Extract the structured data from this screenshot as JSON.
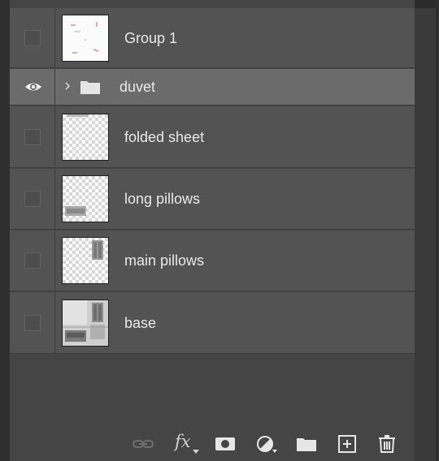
{
  "layers": [
    {
      "name": "Group 1",
      "visible": false,
      "type": "layer",
      "thumb": "group1"
    },
    {
      "name": "duvet",
      "visible": true,
      "type": "group",
      "selected": true
    },
    {
      "name": "folded sheet",
      "visible": false,
      "type": "layer",
      "thumb": "folded"
    },
    {
      "name": "long pillows",
      "visible": false,
      "type": "layer",
      "thumb": "long"
    },
    {
      "name": "main pillows",
      "visible": false,
      "type": "layer",
      "thumb": "main"
    },
    {
      "name": "base",
      "visible": false,
      "type": "layer",
      "thumb": "base"
    }
  ],
  "footer": {
    "fx_label": "fx",
    "icons": [
      "link-icon",
      "fx-icon",
      "mask-icon",
      "adjustment-icon",
      "new-group-icon",
      "new-layer-icon",
      "trash-icon"
    ]
  },
  "colors": {
    "panel": "#454545",
    "row": "#535353",
    "selected_row": "#6b6b6b",
    "text": "#e8e8e8"
  }
}
